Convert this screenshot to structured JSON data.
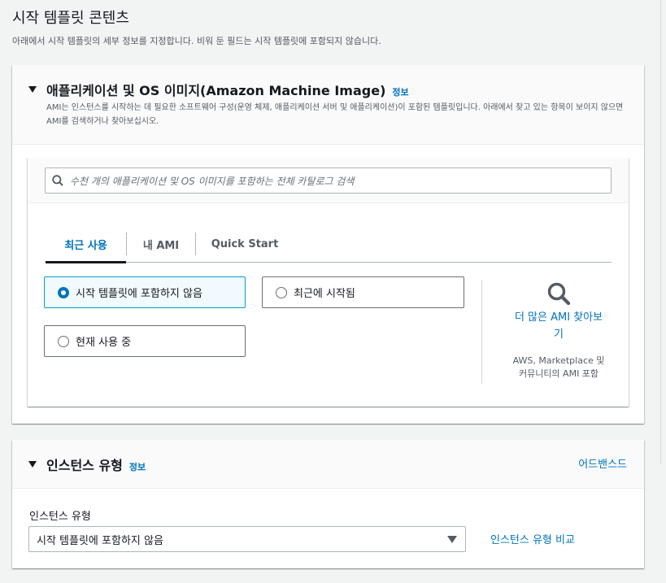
{
  "page": {
    "title": "시작 템플릿 콘텐츠",
    "description": "아래에서 시작 템플릿의 세부 정보를 지정합니다. 비워 둔 필드는 시작 템플릿에 포함되지 않습니다."
  },
  "ami_section": {
    "title": "애플리케이션 및 OS 이미지(Amazon Machine Image)",
    "info_link": "정보",
    "description": "AMI는 인스턴스를 시작하는 데 필요한 소프트웨어 구성(운영 체제, 애플리케이션 서버 및 애플리케이션)이 포함된 템플릿입니다. 아래에서 찾고 있는 항목이 보이지 않으면 AMI를 검색하거나 찾아보십시오.",
    "search": {
      "placeholder": "수천 개의 애플리케이션 및 OS 이미지를 포함하는 전체 카탈로그 검색",
      "value": ""
    },
    "tabs": [
      {
        "label": "최근 사용",
        "active": true
      },
      {
        "label": "내 AMI",
        "active": false
      },
      {
        "label": "Quick Start",
        "active": false
      }
    ],
    "options": [
      {
        "label": "시작 템플릿에 포함하지 않음",
        "selected": true
      },
      {
        "label": "최근에 시작됨",
        "selected": false
      },
      {
        "label": "현재 사용 중",
        "selected": false
      }
    ],
    "browse": {
      "link_line1": "더 많은 AMI 찾아보",
      "link_line2": "기",
      "sub_line1": "AWS, Marketplace 및",
      "sub_line2": "커뮤니티의 AMI 포함"
    }
  },
  "instance_section": {
    "title": "인스턴스 유형",
    "info_link": "정보",
    "advanced_link": "어드밴스드",
    "field_label": "인스턴스 유형",
    "selected_value": "시작 템플릿에 포함하지 않음",
    "compare_link": "인스턴스 유형 비교"
  },
  "colors": {
    "link": "#0073bb",
    "selected_border": "#00a1c9",
    "selected_bg": "#f1faff",
    "background": "#f2f3f3"
  },
  "icons": [
    "caret-down-icon",
    "search-icon",
    "magnifier-icon",
    "select-caret-icon"
  ]
}
